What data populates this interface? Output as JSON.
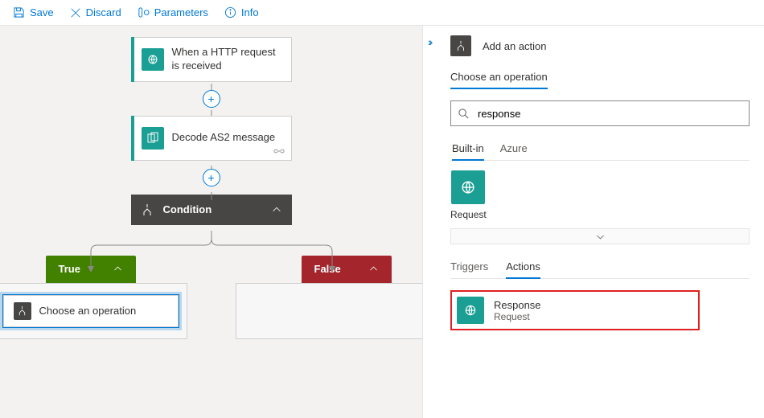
{
  "toolbar": {
    "save": "Save",
    "discard": "Discard",
    "parameters": "Parameters",
    "info": "Info"
  },
  "flow": {
    "trigger": "When a HTTP request is received",
    "step1": "Decode AS2 message",
    "condition": "Condition",
    "true_label": "True",
    "false_label": "False",
    "choose_op": "Choose an operation"
  },
  "panel": {
    "header": "Add an action",
    "choose_label": "Choose an operation",
    "search_value": "response",
    "scope": {
      "builtin": "Built-in",
      "azure": "Azure"
    },
    "connector": {
      "request": "Request"
    },
    "result_tabs": {
      "triggers": "Triggers",
      "actions": "Actions"
    },
    "result": {
      "name": "Response",
      "sub": "Request"
    }
  }
}
